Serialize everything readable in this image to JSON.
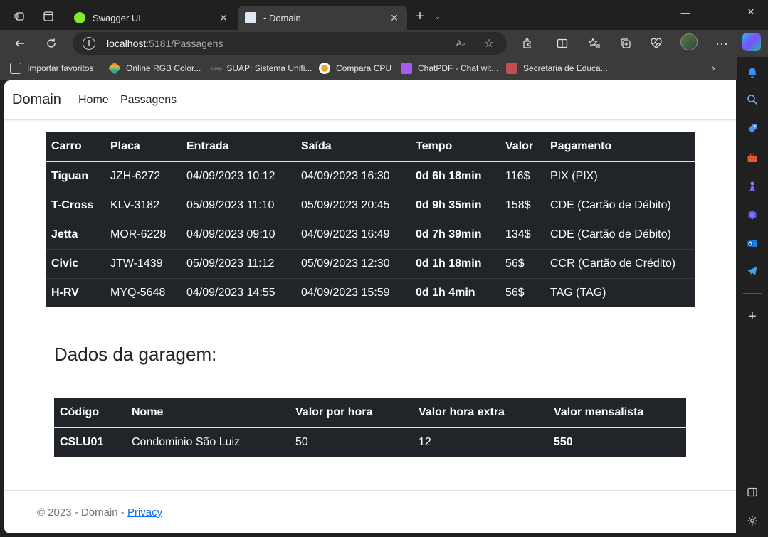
{
  "browser": {
    "tabs": [
      {
        "title": "Swagger UI",
        "favicon_color": "#85ea2d"
      },
      {
        "title": "- Domain",
        "favicon_color": "#dfe7f1"
      }
    ],
    "address": {
      "host": "localhost",
      "path": ":5181/Passagens"
    },
    "bookmarks": [
      {
        "label": "Importar favoritos",
        "color": "#cfcfcf"
      },
      {
        "label": "Online RGB Color...",
        "color": "#e8b23a"
      },
      {
        "label": "SUAP: Sistema Unifi...",
        "color": "#555555",
        "prefix": "suap"
      },
      {
        "label": "Compara CPU",
        "color": "#f5a623"
      },
      {
        "label": "ChatPDF - Chat wit...",
        "color": "#a55cf0"
      },
      {
        "label": "Secretaria de Educa...",
        "color": "#c0504d"
      }
    ]
  },
  "page": {
    "brand": "Domain",
    "nav": [
      "Home",
      "Passagens"
    ],
    "passagens": {
      "headers": [
        "Carro",
        "Placa",
        "Entrada",
        "Saída",
        "Tempo",
        "Valor",
        "Pagamento"
      ],
      "rows": [
        [
          "Tiguan",
          "JZH-6272",
          "04/09/2023 10:12",
          "04/09/2023 16:30",
          "0d 6h 18min",
          "116$",
          "PIX (PIX)"
        ],
        [
          "T-Cross",
          "KLV-3182",
          "05/09/2023 11:10",
          "05/09/2023 20:45",
          "0d 9h 35min",
          "158$",
          "CDE (Cartão de Débito)"
        ],
        [
          "Jetta",
          "MOR-6228",
          "04/09/2023 09:10",
          "04/09/2023 16:49",
          "0d 7h 39min",
          "134$",
          "CDE (Cartão de Débito)"
        ],
        [
          "Civic",
          "JTW-1439",
          "05/09/2023 11:12",
          "05/09/2023 12:30",
          "0d 1h 18min",
          "56$",
          "CCR (Cartão de Crédito)"
        ],
        [
          "H-RV",
          "MYQ-5648",
          "04/09/2023 14:55",
          "04/09/2023 15:59",
          "0d 1h 4min",
          "56$",
          "TAG (TAG)"
        ]
      ]
    },
    "garagem": {
      "title": "Dados da garagem:",
      "headers": [
        "Código",
        "Nome",
        "Valor por hora",
        "Valor hora extra",
        "Valor mensalista"
      ],
      "row": [
        "CSLU01",
        "Condominio São Luiz",
        "50",
        "12",
        "550"
      ]
    },
    "footer": {
      "text": "© 2023 - Domain - ",
      "link": "Privacy"
    }
  }
}
